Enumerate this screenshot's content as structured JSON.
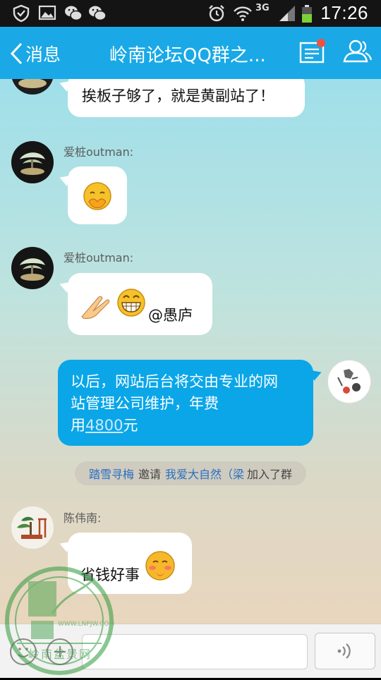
{
  "status_bar": {
    "time": "17:26",
    "network": "3G"
  },
  "nav": {
    "back_label": "消息",
    "title": "岭南论坛QQ群之..."
  },
  "messages": [
    {
      "text": "挨板子够了，就是黄副站了！"
    },
    {
      "sender": "爱桩outman:"
    },
    {
      "sender": "爱桩outman:",
      "mention": "@愚庐"
    },
    {
      "text_line1": "以后，网站后台将交由专业的网",
      "text_line2": "站管理公司维护，年费",
      "text_line3_prefix": "用",
      "text_line3_number": "4800",
      "text_line3_suffix": "元"
    },
    {
      "sender": "陈伟南:",
      "text": "省钱好事"
    }
  ],
  "system_notice": {
    "inviter": "踏雪寻梅",
    "verb": "邀请",
    "invitee": "我爱大自然（梁",
    "action": "加入了群"
  },
  "watermark": {
    "text": "WWW.LNPJW.COM",
    "name": "岭南盆景网"
  },
  "colors": {
    "nav_bg": "#1aa9e6",
    "my_bubble": "#0aa6e8",
    "link": "#2a6fc0"
  }
}
